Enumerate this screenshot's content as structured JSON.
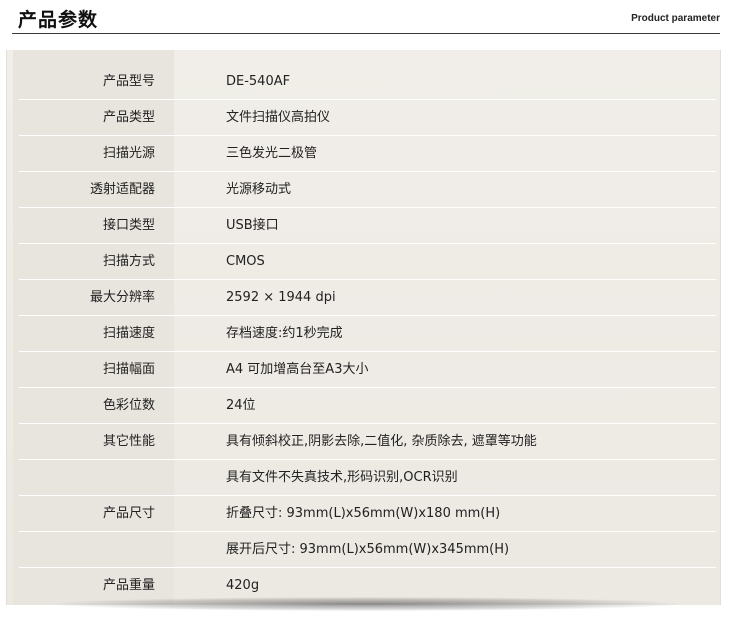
{
  "header": {
    "title": "产品参数",
    "subtitle": "Product parameter"
  },
  "specs": [
    {
      "label": "产品型号",
      "value": "DE-540AF"
    },
    {
      "label": "产品类型",
      "value": "文件扫描仪高拍仪"
    },
    {
      "label": "扫描光源",
      "value": "三色发光二极管"
    },
    {
      "label": "透射适配器",
      "value": "光源移动式"
    },
    {
      "label": "接口类型",
      "value": "USB接口"
    },
    {
      "label": "扫描方式",
      "value": "CMOS"
    },
    {
      "label": "最大分辨率",
      "value": "2592 × 1944 dpi"
    },
    {
      "label": "扫描速度",
      "value": "存档速度:约1秒完成"
    },
    {
      "label": "扫描幅面",
      "value": "A4 可加增高台至A3大小"
    },
    {
      "label": "色彩位数",
      "value": "24位"
    },
    {
      "label": "其它性能",
      "value": "具有倾斜校正,阴影去除,二值化, 杂质除去, 遮罩等功能"
    },
    {
      "label": "",
      "value": "具有文件不失真技术,形码识别,OCR识别"
    },
    {
      "label": "产品尺寸",
      "value": "折叠尺寸: 93mm(L)x56mm(W)x180 mm(H)"
    },
    {
      "label": "",
      "value": "展开后尺寸: 93mm(L)x56mm(W)x345mm(H)"
    },
    {
      "label": "产品重量",
      "value": "420g"
    }
  ]
}
